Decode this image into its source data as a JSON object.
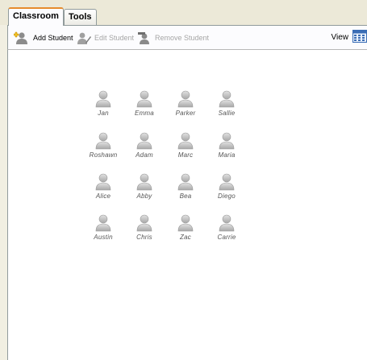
{
  "tabs": [
    {
      "label": "Classroom",
      "active": true
    },
    {
      "label": "Tools",
      "active": false
    }
  ],
  "toolbar": {
    "add_student": {
      "label": "Add Student",
      "icon": "add-user-icon",
      "enabled": true
    },
    "edit_student": {
      "label": "Edit Student",
      "icon": "edit-user-icon",
      "enabled": false
    },
    "remove_student": {
      "label": "Remove Student",
      "icon": "remove-user-icon",
      "enabled": false
    },
    "view": {
      "label": "View",
      "icon": "calendar-grid-icon"
    }
  },
  "students": [
    [
      "Jan",
      "Emma",
      "Parker",
      "Sallie"
    ],
    [
      "Roshawn",
      "Adam",
      "Marc",
      "Maria"
    ],
    [
      "Alice",
      "Abby",
      "Bea",
      "Diego"
    ],
    [
      "Austin",
      "Chris",
      "Zac",
      "Carrie"
    ]
  ],
  "colors": {
    "accent_tab": "#e68b2c",
    "student_icon": "#bdbdbd",
    "disabled_text": "#a6a6a6"
  }
}
